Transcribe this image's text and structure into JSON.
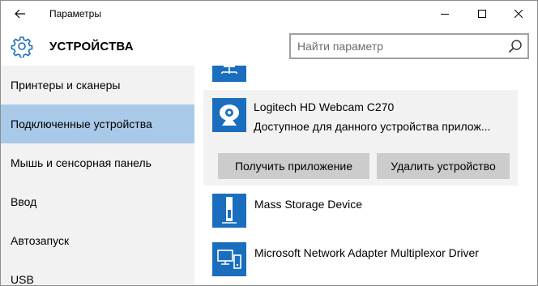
{
  "window": {
    "title": "Параметры"
  },
  "header": {
    "section_title": "УСТРОЙСТВА",
    "search_placeholder": "Найти параметр"
  },
  "sidebar": {
    "items": [
      {
        "label": "Принтеры и сканеры",
        "active": false
      },
      {
        "label": "Подключенные устройства",
        "active": true
      },
      {
        "label": "Мышь и сенсорная панель",
        "active": false
      },
      {
        "label": "Ввод",
        "active": false
      },
      {
        "label": "Автозапуск",
        "active": false
      },
      {
        "label": "USB",
        "active": false
      }
    ]
  },
  "devices": {
    "selected": {
      "name": "Logitech HD Webcam C270",
      "status": "Доступное для данного устройства прилож...",
      "get_app_label": "Получить приложение",
      "remove_label": "Удалить устройство",
      "icon": "webcam-icon"
    },
    "list": [
      {
        "name": "Mass Storage Device",
        "icon": "usb-drive-icon"
      },
      {
        "name": "Microsoft Network Adapter Multiplexor Driver",
        "icon": "network-adapter-icon"
      }
    ],
    "partial_top_icon": "network-device-icon"
  },
  "colors": {
    "accent": "#1b6ebe",
    "sidebar_bg": "#f2f2f2",
    "sidebar_active": "#a9c9e8",
    "button_bg": "#cccccc"
  }
}
